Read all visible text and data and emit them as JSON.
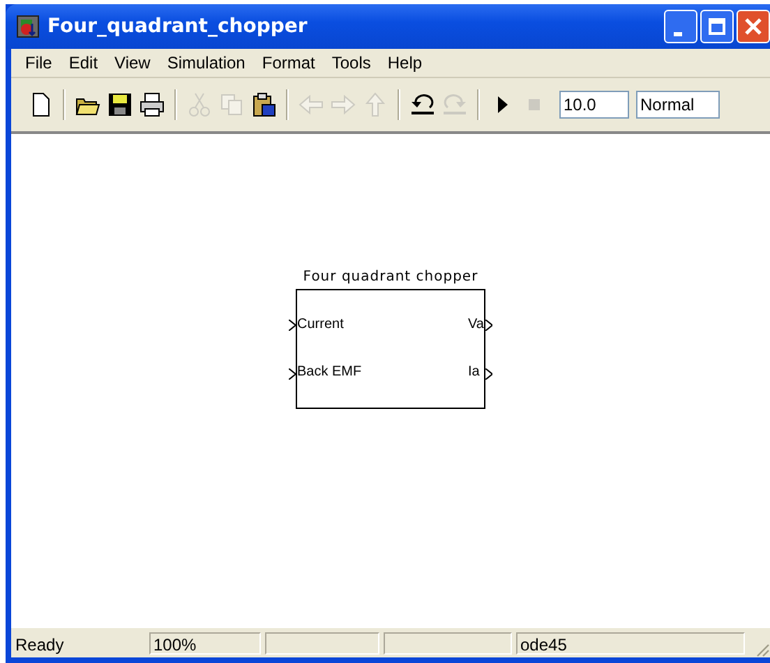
{
  "window": {
    "title": "Four_quadrant_chopper"
  },
  "menu": [
    "File",
    "Edit",
    "View",
    "Simulation",
    "Format",
    "Tools",
    "Help"
  ],
  "toolbar": [
    {
      "kind": "new",
      "disabled": false
    },
    {
      "kind": "separator"
    },
    {
      "kind": "open",
      "disabled": false
    },
    {
      "kind": "save",
      "disabled": false
    },
    {
      "kind": "print",
      "disabled": false
    },
    {
      "kind": "separator"
    },
    {
      "kind": "cut",
      "disabled": true
    },
    {
      "kind": "copy",
      "disabled": true
    },
    {
      "kind": "paste",
      "disabled": false
    },
    {
      "kind": "separator"
    },
    {
      "kind": "back",
      "disabled": true
    },
    {
      "kind": "forward",
      "disabled": true
    },
    {
      "kind": "up",
      "disabled": true
    },
    {
      "kind": "separator"
    },
    {
      "kind": "undo",
      "disabled": false
    },
    {
      "kind": "redo",
      "disabled": true
    },
    {
      "kind": "separator"
    },
    {
      "kind": "play",
      "disabled": false
    },
    {
      "kind": "stop",
      "disabled": true
    }
  ],
  "stop_time": "10.0",
  "sim_mode": "Normal",
  "block": {
    "title": "Four quadrant chopper",
    "inputs": [
      "Current",
      "Back EMF"
    ],
    "outputs": [
      "Va",
      "Ia"
    ]
  },
  "status_bar": {
    "message": "Ready",
    "zoom": "100%",
    "solver": "ode45"
  }
}
